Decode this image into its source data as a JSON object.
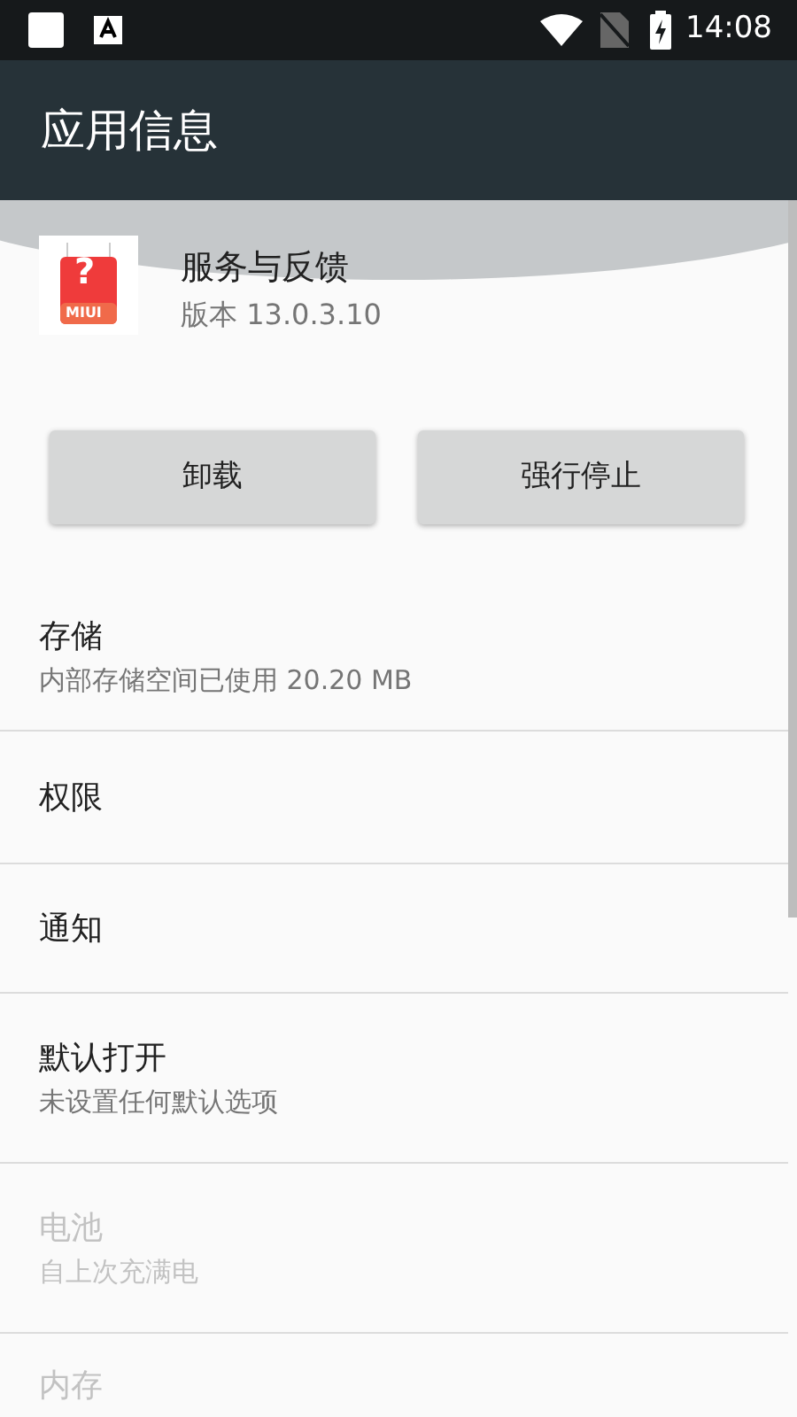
{
  "status_bar": {
    "time": "14:08"
  },
  "toolbar": {
    "title": "应用信息"
  },
  "app": {
    "name": "服务与反馈",
    "version": "版本 13.0.3.10",
    "icon_text": "MIUI",
    "icon_glyph": "?"
  },
  "buttons": [
    {
      "label": "卸载"
    },
    {
      "label": "强行停止"
    }
  ],
  "settings": [
    {
      "title": "存储",
      "summary": "内部存储空间已使用 20.20 MB",
      "disabled": false
    },
    {
      "title": "权限",
      "disabled": false
    },
    {
      "title": "通知",
      "disabled": false
    },
    {
      "title": "默认打开",
      "summary": "未设置任何默认选项",
      "disabled": false
    },
    {
      "title": "电池",
      "summary": "自上次充满电",
      "disabled": true
    },
    {
      "title": "内存",
      "disabled": true
    }
  ]
}
